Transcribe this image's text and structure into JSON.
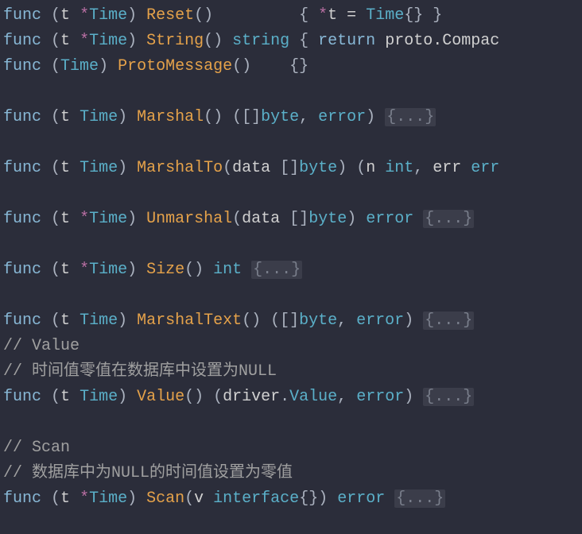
{
  "lines": [
    {
      "segments": [
        {
          "t": "func",
          "c": "kw"
        },
        {
          "t": " ",
          "c": ""
        },
        {
          "t": "(",
          "c": "punct"
        },
        {
          "t": "t ",
          "c": "var"
        },
        {
          "t": "*",
          "c": "ptr"
        },
        {
          "t": "Time",
          "c": "type"
        },
        {
          "t": ") ",
          "c": "punct"
        },
        {
          "t": "Reset",
          "c": "name"
        },
        {
          "t": "()         { ",
          "c": "punct"
        },
        {
          "t": "*",
          "c": "ptr"
        },
        {
          "t": "t = ",
          "c": "var"
        },
        {
          "t": "Time",
          "c": "type"
        },
        {
          "t": "{} }",
          "c": "punct"
        }
      ]
    },
    {
      "segments": [
        {
          "t": "func",
          "c": "kw"
        },
        {
          "t": " ",
          "c": ""
        },
        {
          "t": "(",
          "c": "punct"
        },
        {
          "t": "t ",
          "c": "var"
        },
        {
          "t": "*",
          "c": "ptr"
        },
        {
          "t": "Time",
          "c": "type"
        },
        {
          "t": ") ",
          "c": "punct"
        },
        {
          "t": "String",
          "c": "name"
        },
        {
          "t": "() ",
          "c": "punct"
        },
        {
          "t": "string",
          "c": "type"
        },
        {
          "t": " { ",
          "c": "punct"
        },
        {
          "t": "return",
          "c": "kw"
        },
        {
          "t": " proto.Compac",
          "c": "var"
        }
      ]
    },
    {
      "segments": [
        {
          "t": "func",
          "c": "kw"
        },
        {
          "t": " ",
          "c": ""
        },
        {
          "t": "(",
          "c": "punct"
        },
        {
          "t": "Time",
          "c": "type"
        },
        {
          "t": ") ",
          "c": "punct"
        },
        {
          "t": "ProtoMessage",
          "c": "name"
        },
        {
          "t": "()    {}",
          "c": "punct"
        }
      ]
    },
    {
      "segments": [
        {
          "t": " ",
          "c": ""
        }
      ]
    },
    {
      "segments": [
        {
          "t": "func",
          "c": "kw"
        },
        {
          "t": " ",
          "c": ""
        },
        {
          "t": "(",
          "c": "punct"
        },
        {
          "t": "t ",
          "c": "var"
        },
        {
          "t": "Time",
          "c": "type"
        },
        {
          "t": ") ",
          "c": "punct"
        },
        {
          "t": "Marshal",
          "c": "name"
        },
        {
          "t": "() ([]",
          "c": "punct"
        },
        {
          "t": "byte",
          "c": "type"
        },
        {
          "t": ", ",
          "c": "punct"
        },
        {
          "t": "error",
          "c": "type"
        },
        {
          "t": ") ",
          "c": "punct"
        },
        {
          "t": "{...}",
          "c": "fold"
        }
      ]
    },
    {
      "segments": [
        {
          "t": " ",
          "c": ""
        }
      ]
    },
    {
      "segments": [
        {
          "t": "func",
          "c": "kw"
        },
        {
          "t": " ",
          "c": ""
        },
        {
          "t": "(",
          "c": "punct"
        },
        {
          "t": "t ",
          "c": "var"
        },
        {
          "t": "Time",
          "c": "type"
        },
        {
          "t": ") ",
          "c": "punct"
        },
        {
          "t": "MarshalTo",
          "c": "name"
        },
        {
          "t": "(",
          "c": "punct"
        },
        {
          "t": "data ",
          "c": "var"
        },
        {
          "t": "[]",
          "c": "punct"
        },
        {
          "t": "byte",
          "c": "type"
        },
        {
          "t": ") (",
          "c": "punct"
        },
        {
          "t": "n ",
          "c": "var"
        },
        {
          "t": "int",
          "c": "type"
        },
        {
          "t": ", ",
          "c": "punct"
        },
        {
          "t": "err ",
          "c": "var"
        },
        {
          "t": "err",
          "c": "type"
        }
      ]
    },
    {
      "segments": [
        {
          "t": " ",
          "c": ""
        }
      ]
    },
    {
      "segments": [
        {
          "t": "func",
          "c": "kw"
        },
        {
          "t": " ",
          "c": ""
        },
        {
          "t": "(",
          "c": "punct"
        },
        {
          "t": "t ",
          "c": "var"
        },
        {
          "t": "*",
          "c": "ptr"
        },
        {
          "t": "Time",
          "c": "type"
        },
        {
          "t": ") ",
          "c": "punct"
        },
        {
          "t": "Unmarshal",
          "c": "name"
        },
        {
          "t": "(",
          "c": "punct"
        },
        {
          "t": "data ",
          "c": "var"
        },
        {
          "t": "[]",
          "c": "punct"
        },
        {
          "t": "byte",
          "c": "type"
        },
        {
          "t": ") ",
          "c": "punct"
        },
        {
          "t": "error",
          "c": "type"
        },
        {
          "t": " ",
          "c": ""
        },
        {
          "t": "{...}",
          "c": "fold"
        }
      ]
    },
    {
      "segments": [
        {
          "t": " ",
          "c": ""
        }
      ]
    },
    {
      "segments": [
        {
          "t": "func",
          "c": "kw"
        },
        {
          "t": " ",
          "c": ""
        },
        {
          "t": "(",
          "c": "punct"
        },
        {
          "t": "t ",
          "c": "var"
        },
        {
          "t": "*",
          "c": "ptr"
        },
        {
          "t": "Time",
          "c": "type"
        },
        {
          "t": ") ",
          "c": "punct"
        },
        {
          "t": "Size",
          "c": "name"
        },
        {
          "t": "() ",
          "c": "punct"
        },
        {
          "t": "int",
          "c": "type"
        },
        {
          "t": " ",
          "c": ""
        },
        {
          "t": "{...}",
          "c": "fold"
        }
      ]
    },
    {
      "segments": [
        {
          "t": " ",
          "c": ""
        }
      ]
    },
    {
      "segments": [
        {
          "t": "func",
          "c": "kw"
        },
        {
          "t": " ",
          "c": ""
        },
        {
          "t": "(",
          "c": "punct"
        },
        {
          "t": "t ",
          "c": "var"
        },
        {
          "t": "Time",
          "c": "type"
        },
        {
          "t": ") ",
          "c": "punct"
        },
        {
          "t": "MarshalText",
          "c": "name"
        },
        {
          "t": "() ([]",
          "c": "punct"
        },
        {
          "t": "byte",
          "c": "type"
        },
        {
          "t": ", ",
          "c": "punct"
        },
        {
          "t": "error",
          "c": "type"
        },
        {
          "t": ") ",
          "c": "punct"
        },
        {
          "t": "{...}",
          "c": "fold"
        }
      ]
    },
    {
      "segments": [
        {
          "t": "// Value",
          "c": "comment"
        }
      ]
    },
    {
      "segments": [
        {
          "t": "// 时间值零值在数据库中设置为NULL",
          "c": "comment"
        }
      ]
    },
    {
      "segments": [
        {
          "t": "func",
          "c": "kw"
        },
        {
          "t": " ",
          "c": ""
        },
        {
          "t": "(",
          "c": "punct"
        },
        {
          "t": "t ",
          "c": "var"
        },
        {
          "t": "Time",
          "c": "type"
        },
        {
          "t": ") ",
          "c": "punct"
        },
        {
          "t": "Value",
          "c": "name"
        },
        {
          "t": "() (",
          "c": "punct"
        },
        {
          "t": "driver",
          "c": "var"
        },
        {
          "t": ".",
          "c": "punct"
        },
        {
          "t": "Value",
          "c": "type"
        },
        {
          "t": ", ",
          "c": "punct"
        },
        {
          "t": "error",
          "c": "type"
        },
        {
          "t": ") ",
          "c": "punct"
        },
        {
          "t": "{...}",
          "c": "fold"
        }
      ]
    },
    {
      "segments": [
        {
          "t": " ",
          "c": ""
        }
      ]
    },
    {
      "segments": [
        {
          "t": "// Scan",
          "c": "comment"
        }
      ]
    },
    {
      "segments": [
        {
          "t": "// 数据库中为NULL的时间值设置为零值",
          "c": "comment"
        }
      ]
    },
    {
      "segments": [
        {
          "t": "func",
          "c": "kw"
        },
        {
          "t": " ",
          "c": ""
        },
        {
          "t": "(",
          "c": "punct"
        },
        {
          "t": "t ",
          "c": "var"
        },
        {
          "t": "*",
          "c": "ptr"
        },
        {
          "t": "Time",
          "c": "type"
        },
        {
          "t": ") ",
          "c": "punct"
        },
        {
          "t": "Scan",
          "c": "name"
        },
        {
          "t": "(",
          "c": "punct"
        },
        {
          "t": "v ",
          "c": "var"
        },
        {
          "t": "interface",
          "c": "type"
        },
        {
          "t": "{}) ",
          "c": "punct"
        },
        {
          "t": "error",
          "c": "type"
        },
        {
          "t": " ",
          "c": ""
        },
        {
          "t": "{...}",
          "c": "fold"
        }
      ]
    }
  ]
}
